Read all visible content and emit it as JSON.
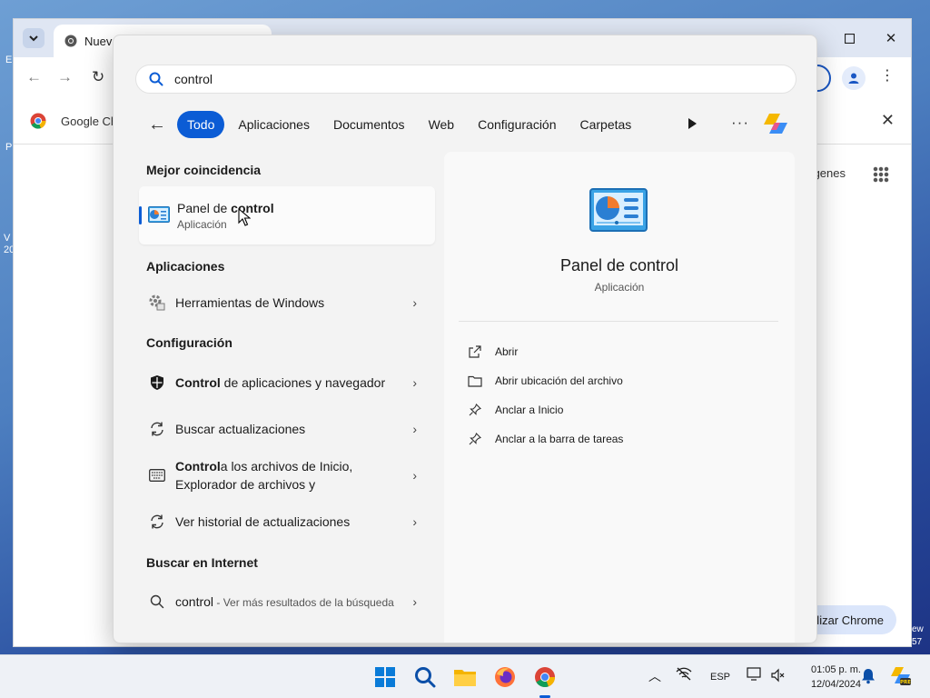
{
  "chrome": {
    "tab_title": "Nueva pestaña",
    "infobar_text": "Google Chrome",
    "imagenes_label": "Imágenes",
    "personalize_label": "Personalizar Chrome"
  },
  "search": {
    "query": "control",
    "filters": [
      "Todo",
      "Aplicaciones",
      "Documentos",
      "Web",
      "Configuración",
      "Carpetas"
    ],
    "active_filter": "Todo",
    "best_match": {
      "heading": "Mejor coincidencia",
      "title_pre": "Panel de ",
      "title_hl": "control",
      "subtitle": "Aplicación"
    },
    "apps": {
      "heading": "Aplicaciones",
      "items": [
        {
          "label": "Herramientas de Windows"
        }
      ]
    },
    "settings": {
      "heading": "Configuración",
      "items": [
        {
          "hl": "Control",
          "rest": " de aplicaciones y navegador"
        },
        {
          "hl": "",
          "rest": "Buscar actualizaciones"
        },
        {
          "hl": "Control",
          "rest": "a los archivos de Inicio, Explorador de archivos y"
        },
        {
          "hl": "",
          "rest": "Ver historial de actualizaciones"
        }
      ]
    },
    "web": {
      "heading": "Buscar en Internet",
      "query": "control",
      "suffix": " - Ver más resultados de la búsqueda"
    },
    "preview": {
      "title": "Panel de control",
      "subtitle": "Aplicación",
      "actions": [
        {
          "label": "Abrir",
          "icon": "open-external-icon"
        },
        {
          "label": "Abrir ubicación del archivo",
          "icon": "folder-icon"
        },
        {
          "label": "Anclar a Inicio",
          "icon": "pin-icon"
        },
        {
          "label": "Anclar a la barra de tareas",
          "icon": "pin-icon"
        }
      ]
    }
  },
  "taskbar": {
    "lang": "ESP",
    "time": "01:05 p. m.",
    "date": "12/04/2024"
  },
  "colors": {
    "accent": "#0b5cd5"
  }
}
